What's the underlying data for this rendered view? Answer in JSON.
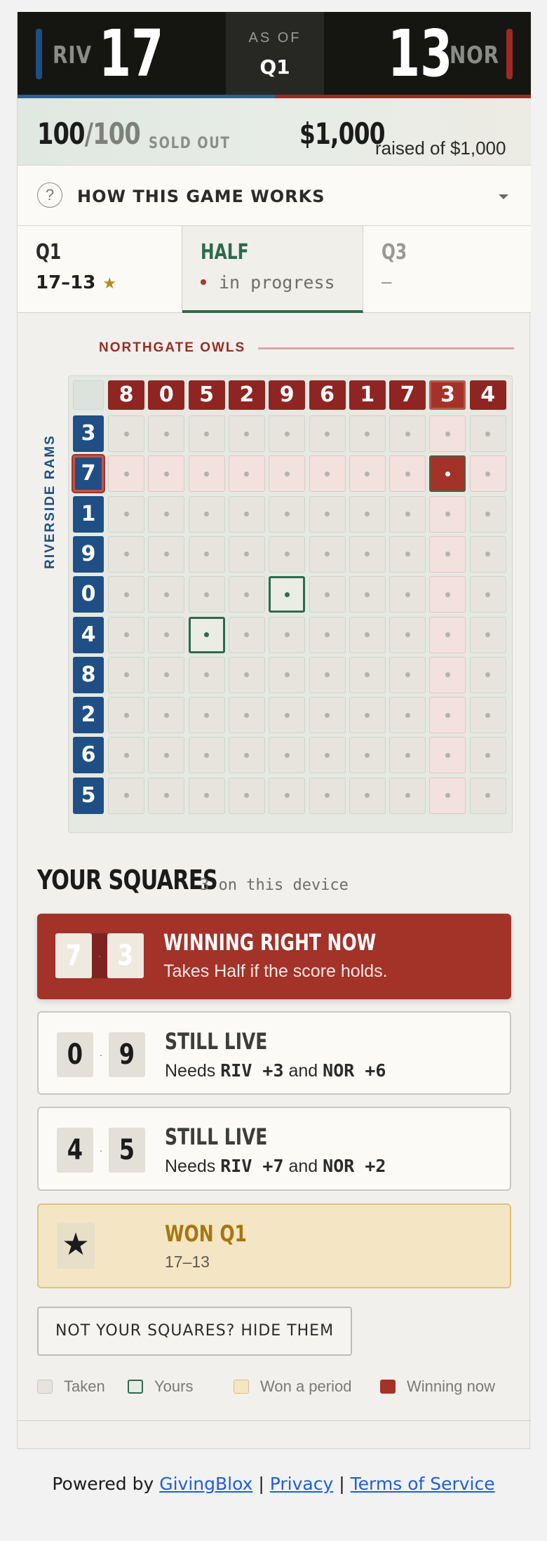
{
  "scoreboard": {
    "home_abbr": "RIV",
    "home_score": "17",
    "away_abbr": "NOR",
    "away_score": "13",
    "asof_label": "AS OF",
    "asof_period": "Q1",
    "colors": {
      "home": "#1d4f82",
      "away": "#9b2a24",
      "background": "#151612"
    }
  },
  "sales": {
    "sold": "100",
    "total": "/100",
    "status": "SOLD OUT",
    "raised": "$1,000",
    "raised_text": "raised of $1,000"
  },
  "how_it_works": {
    "label": "HOW THIS GAME WORKS",
    "icon": "help-circle-icon",
    "caret": "chevron-down-icon"
  },
  "tabs": [
    {
      "name": "Q1",
      "sub": "17–13",
      "star": "★"
    },
    {
      "name": "HALF",
      "sub": "in progress"
    },
    {
      "name": "Q3",
      "sub": "—"
    }
  ],
  "grid": {
    "away_team": "NORTHGATE OWLS",
    "home_team": "RIVERSIDE RAMS",
    "col_numbers": [
      "8",
      "0",
      "5",
      "2",
      "9",
      "6",
      "1",
      "7",
      "3",
      "4"
    ],
    "row_numbers": [
      "3",
      "7",
      "1",
      "9",
      "0",
      "4",
      "8",
      "2",
      "6",
      "5"
    ],
    "winning_col": "3",
    "winning_row": "7",
    "your_squares": [
      {
        "row": "7",
        "col": "3",
        "state": "winning"
      },
      {
        "row": "0",
        "col": "9",
        "state": "live"
      },
      {
        "row": "4",
        "col": "5",
        "state": "live"
      }
    ]
  },
  "your_squares": {
    "title": "YOUR SQUARES",
    "sub": "3 on this device",
    "cards": [
      {
        "a": "7",
        "b": "3",
        "head": "WINNING RIGHT NOW",
        "text": "Takes Half if the score holds."
      },
      {
        "a": "0",
        "b": "9",
        "head": "STILL LIVE",
        "needs": "Needs",
        "t1": "RIV +3",
        "and": "and",
        "t2": "NOR +6"
      },
      {
        "a": "4",
        "b": "5",
        "head": "STILL LIVE",
        "needs": "Needs",
        "t1": "RIV +7",
        "and": "and",
        "t2": "NOR +2"
      },
      {
        "icon": "star-icon",
        "star": "★",
        "head": "WON Q1",
        "text": "17–13"
      }
    ],
    "separator": "·"
  },
  "hide_button": "NOT YOUR SQUARES? HIDE THEM",
  "legend": [
    {
      "label": "Taken",
      "color": "#e6e4dc"
    },
    {
      "label": "Yours",
      "color": "#2e6a4c"
    },
    {
      "label": "Won a period",
      "color": "#f4e6c4"
    },
    {
      "label": "Winning now",
      "color": "#a33229"
    }
  ],
  "footer": {
    "powered": "Powered by",
    "brand": "GivingBlox",
    "sep": "|",
    "privacy": "Privacy",
    "terms": "Terms of Service"
  }
}
